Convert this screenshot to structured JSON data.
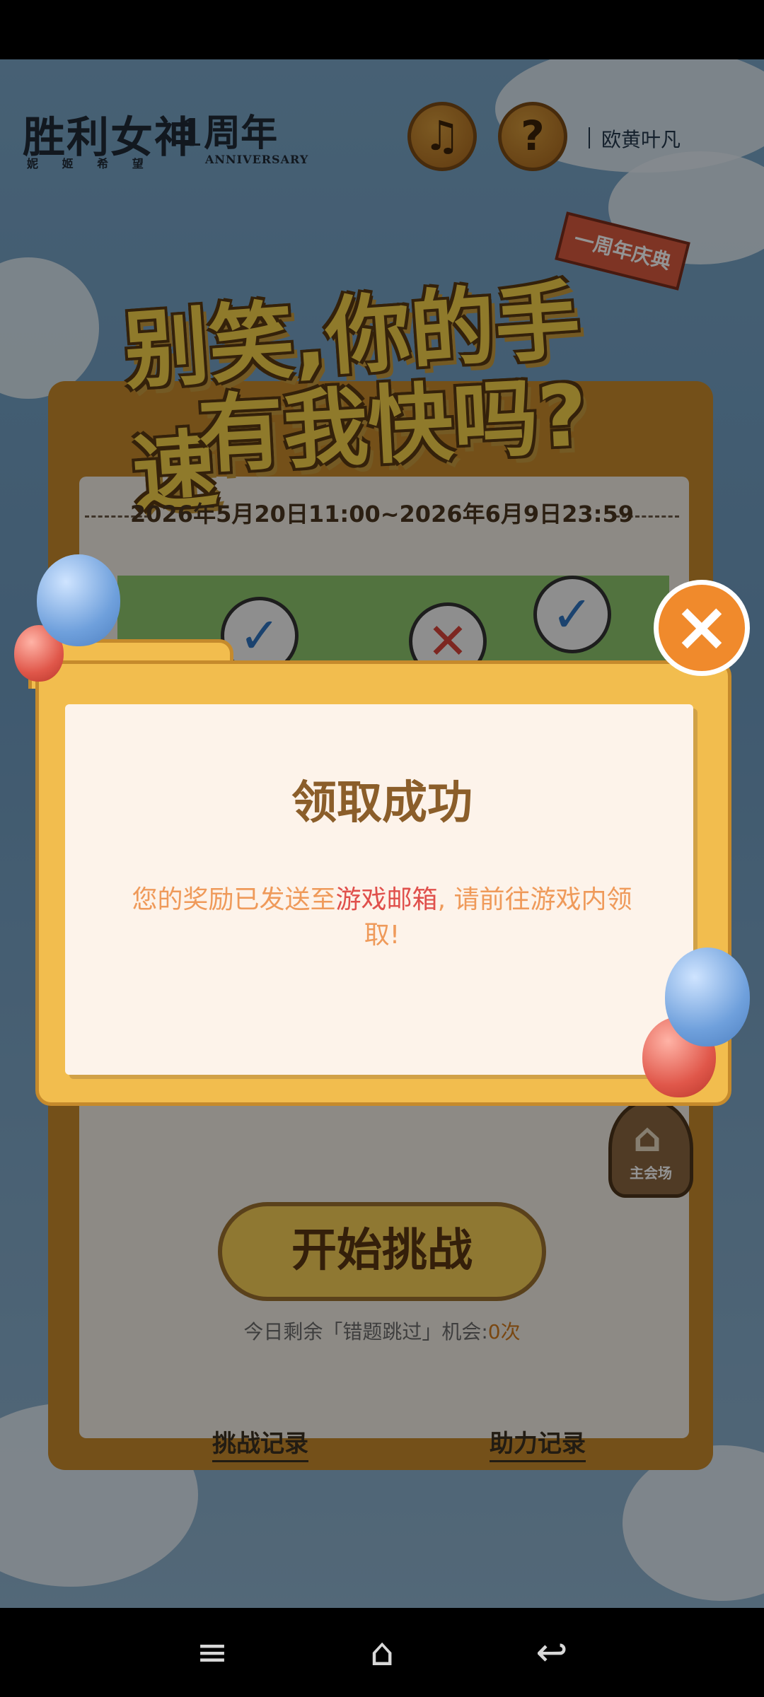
{
  "header": {
    "logo_main": "胜利女神",
    "logo_sub": "妮 姬 希 望",
    "logo_anniversary": "1周年",
    "logo_anniversary_sub": "ANNIVERSARY",
    "music_label": "♫",
    "help_label": "?",
    "username": "欧黄叶凡"
  },
  "event": {
    "ribbon": "一周年庆典",
    "title_line1": "别笑,你的手速",
    "title_line2": "有我快吗?",
    "date_range": "2026年5月20日11:00~2026年6月9日23:59",
    "start_button": "开始挑战",
    "skip_prefix": "今日剩余「错题跳过」机会:",
    "skip_count": "0次",
    "home_label": "主会场",
    "challenge_record": "挑战记录",
    "assist_record": "助力记录"
  },
  "modal": {
    "title": "领取成功",
    "message_part1": "您的奖励已发送至",
    "mail_link": "游戏邮箱",
    "message_part2": ", 请前往游戏内领取!",
    "close_label": "×"
  },
  "system_nav": {
    "menu_icon": "≡",
    "home_icon": "⌂",
    "back_icon": "↩"
  }
}
